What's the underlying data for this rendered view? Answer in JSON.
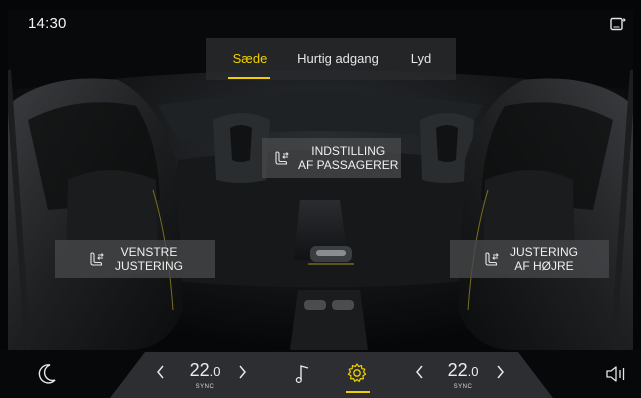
{
  "status_bar": {
    "time": "14:30"
  },
  "tabs": [
    {
      "label": "Sæde",
      "active": true
    },
    {
      "label": "Hurtig adgang",
      "active": false
    },
    {
      "label": "Lyd",
      "active": false
    }
  ],
  "seat_panels": {
    "passenger": {
      "line1": "INDSTILLING",
      "line2": "AF PASSAGERER"
    },
    "left": {
      "line1": "VENSTRE",
      "line2": "JUSTERING"
    },
    "right": {
      "line1": "JUSTERING",
      "line2": "AF HØJRE"
    }
  },
  "climate": {
    "left_temp": {
      "value": "22",
      "unit": ".0",
      "sync_label": "SYNC"
    },
    "right_temp": {
      "value": "22",
      "unit": ".0",
      "sync_label": "SYNC"
    }
  },
  "icons": {
    "night_mode": "moon-icon",
    "music": "music-note-icon",
    "settings": "gear-icon",
    "volume": "speaker-icon",
    "seat": "seat-adjust-icon",
    "phone_status": "phone-mirror-icon"
  },
  "colors": {
    "accent": "#f0d000",
    "panel": "#464a4c",
    "background": "#050607"
  }
}
